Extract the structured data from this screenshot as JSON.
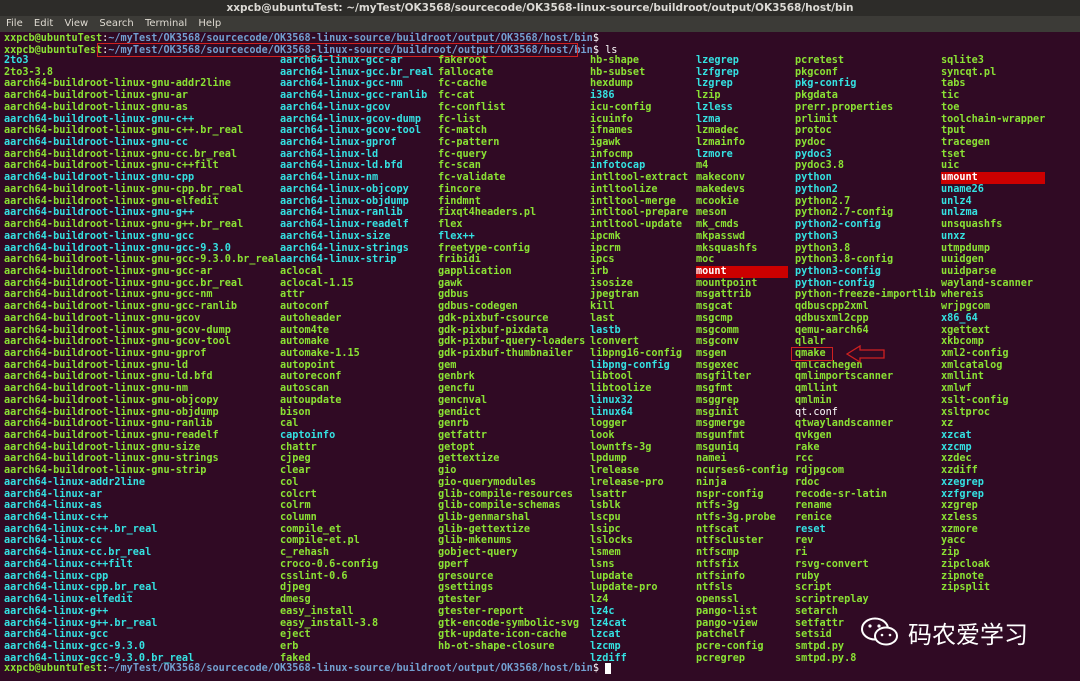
{
  "window": {
    "title": "xxpcb@ubuntuTest: ~/myTest/OK3568/sourcecode/OK3568-linux-source/buildroot/output/OK3568/host/bin"
  },
  "menu": [
    "File",
    "Edit",
    "View",
    "Search",
    "Terminal",
    "Help"
  ],
  "prompt": {
    "user": "xxpcb@ubuntuTest",
    "sep": ":",
    "path": "~/myTest/OK3568/sourcecode/OK3568-linux-source/buildroot/output/OK3568/host/bin",
    "end": "$ "
  },
  "command": "ls",
  "colors": {
    "executable": "#8ae234",
    "symlink": "#34e2e2",
    "directory": "#729fcf",
    "highlight": "#cc0000"
  },
  "columns": [
    [
      [
        "2to3",
        "c"
      ],
      [
        "2to3-3.8",
        "g"
      ],
      [
        "aarch64-buildroot-linux-gnu-addr2line",
        "g"
      ],
      [
        "aarch64-buildroot-linux-gnu-ar",
        "g"
      ],
      [
        "aarch64-buildroot-linux-gnu-as",
        "g"
      ],
      [
        "aarch64-buildroot-linux-gnu-c++",
        "c"
      ],
      [
        "aarch64-buildroot-linux-gnu-c++.br_real",
        "g"
      ],
      [
        "aarch64-buildroot-linux-gnu-cc",
        "c"
      ],
      [
        "aarch64-buildroot-linux-gnu-cc.br_real",
        "g"
      ],
      [
        "aarch64-buildroot-linux-gnu-c++filt",
        "g"
      ],
      [
        "aarch64-buildroot-linux-gnu-cpp",
        "c"
      ],
      [
        "aarch64-buildroot-linux-gnu-cpp.br_real",
        "g"
      ],
      [
        "aarch64-buildroot-linux-gnu-elfedit",
        "g"
      ],
      [
        "aarch64-buildroot-linux-gnu-g++",
        "c"
      ],
      [
        "aarch64-buildroot-linux-gnu-g++.br_real",
        "g"
      ],
      [
        "aarch64-buildroot-linux-gnu-gcc",
        "c"
      ],
      [
        "aarch64-buildroot-linux-gnu-gcc-9.3.0",
        "c"
      ],
      [
        "aarch64-buildroot-linux-gnu-gcc-9.3.0.br_real",
        "g"
      ],
      [
        "aarch64-buildroot-linux-gnu-gcc-ar",
        "g"
      ],
      [
        "aarch64-buildroot-linux-gnu-gcc.br_real",
        "g"
      ],
      [
        "aarch64-buildroot-linux-gnu-gcc-nm",
        "g"
      ],
      [
        "aarch64-buildroot-linux-gnu-gcc-ranlib",
        "g"
      ],
      [
        "aarch64-buildroot-linux-gnu-gcov",
        "g"
      ],
      [
        "aarch64-buildroot-linux-gnu-gcov-dump",
        "g"
      ],
      [
        "aarch64-buildroot-linux-gnu-gcov-tool",
        "g"
      ],
      [
        "aarch64-buildroot-linux-gnu-gprof",
        "g"
      ],
      [
        "aarch64-buildroot-linux-gnu-ld",
        "g"
      ],
      [
        "aarch64-buildroot-linux-gnu-ld.bfd",
        "g"
      ],
      [
        "aarch64-buildroot-linux-gnu-nm",
        "g"
      ],
      [
        "aarch64-buildroot-linux-gnu-objcopy",
        "g"
      ],
      [
        "aarch64-buildroot-linux-gnu-objdump",
        "g"
      ],
      [
        "aarch64-buildroot-linux-gnu-ranlib",
        "g"
      ],
      [
        "aarch64-buildroot-linux-gnu-readelf",
        "g"
      ],
      [
        "aarch64-buildroot-linux-gnu-size",
        "g"
      ],
      [
        "aarch64-buildroot-linux-gnu-strings",
        "g"
      ],
      [
        "aarch64-buildroot-linux-gnu-strip",
        "g"
      ],
      [
        "aarch64-linux-addr2line",
        "c"
      ],
      [
        "aarch64-linux-ar",
        "c"
      ],
      [
        "aarch64-linux-as",
        "c"
      ],
      [
        "aarch64-linux-c++",
        "c"
      ],
      [
        "aarch64-linux-c++.br_real",
        "c"
      ],
      [
        "aarch64-linux-cc",
        "c"
      ],
      [
        "aarch64-linux-cc.br_real",
        "c"
      ],
      [
        "aarch64-linux-c++filt",
        "c"
      ],
      [
        "aarch64-linux-cpp",
        "c"
      ],
      [
        "aarch64-linux-cpp.br_real",
        "c"
      ],
      [
        "aarch64-linux-elfedit",
        "c"
      ],
      [
        "aarch64-linux-g++",
        "c"
      ],
      [
        "aarch64-linux-g++.br_real",
        "c"
      ],
      [
        "aarch64-linux-gcc",
        "c"
      ],
      [
        "aarch64-linux-gcc-9.3.0",
        "c"
      ],
      [
        "aarch64-linux-gcc-9.3.0.br_real",
        "c"
      ]
    ],
    [
      [
        "aarch64-linux-gcc-ar",
        "c"
      ],
      [
        "aarch64-linux-gcc.br_real",
        "c"
      ],
      [
        "aarch64-linux-gcc-nm",
        "c"
      ],
      [
        "aarch64-linux-gcc-ranlib",
        "c"
      ],
      [
        "aarch64-linux-gcov",
        "c"
      ],
      [
        "aarch64-linux-gcov-dump",
        "c"
      ],
      [
        "aarch64-linux-gcov-tool",
        "c"
      ],
      [
        "aarch64-linux-gprof",
        "c"
      ],
      [
        "aarch64-linux-ld",
        "c"
      ],
      [
        "aarch64-linux-ld.bfd",
        "c"
      ],
      [
        "aarch64-linux-nm",
        "c"
      ],
      [
        "aarch64-linux-objcopy",
        "c"
      ],
      [
        "aarch64-linux-objdump",
        "c"
      ],
      [
        "aarch64-linux-ranlib",
        "c"
      ],
      [
        "aarch64-linux-readelf",
        "c"
      ],
      [
        "aarch64-linux-size",
        "c"
      ],
      [
        "aarch64-linux-strings",
        "c"
      ],
      [
        "aarch64-linux-strip",
        "c"
      ],
      [
        "aclocal",
        "g"
      ],
      [
        "aclocal-1.15",
        "g"
      ],
      [
        "attr",
        "g"
      ],
      [
        "autoconf",
        "g"
      ],
      [
        "autoheader",
        "g"
      ],
      [
        "autom4te",
        "g"
      ],
      [
        "automake",
        "g"
      ],
      [
        "automake-1.15",
        "g"
      ],
      [
        "autopoint",
        "g"
      ],
      [
        "autoreconf",
        "g"
      ],
      [
        "autoscan",
        "g"
      ],
      [
        "autoupdate",
        "g"
      ],
      [
        "bison",
        "g"
      ],
      [
        "cal",
        "g"
      ],
      [
        "captoinfo",
        "c"
      ],
      [
        "chattr",
        "g"
      ],
      [
        "cjpeg",
        "g"
      ],
      [
        "clear",
        "g"
      ],
      [
        "col",
        "g"
      ],
      [
        "colcrt",
        "g"
      ],
      [
        "colrm",
        "g"
      ],
      [
        "column",
        "g"
      ],
      [
        "compile_et",
        "g"
      ],
      [
        "compile-et.pl",
        "g"
      ],
      [
        "c_rehash",
        "g"
      ],
      [
        "croco-0.6-config",
        "g"
      ],
      [
        "csslint-0.6",
        "g"
      ],
      [
        "djpeg",
        "g"
      ],
      [
        "dmesg",
        "g"
      ],
      [
        "easy_install",
        "g"
      ],
      [
        "easy_install-3.8",
        "g"
      ],
      [
        "eject",
        "g"
      ],
      [
        "erb",
        "g"
      ],
      [
        "faked",
        "g"
      ]
    ],
    [
      [
        "fakeroot",
        "g"
      ],
      [
        "fallocate",
        "g"
      ],
      [
        "fc-cache",
        "g"
      ],
      [
        "fc-cat",
        "g"
      ],
      [
        "fc-conflist",
        "g"
      ],
      [
        "fc-list",
        "g"
      ],
      [
        "fc-match",
        "g"
      ],
      [
        "fc-pattern",
        "g"
      ],
      [
        "fc-query",
        "g"
      ],
      [
        "fc-scan",
        "g"
      ],
      [
        "fc-validate",
        "g"
      ],
      [
        "fincore",
        "g"
      ],
      [
        "findmnt",
        "g"
      ],
      [
        "fixqt4headers.pl",
        "g"
      ],
      [
        "flex",
        "g"
      ],
      [
        "flex++",
        "c"
      ],
      [
        "freetype-config",
        "g"
      ],
      [
        "fribidi",
        "g"
      ],
      [
        "gapplication",
        "g"
      ],
      [
        "gawk",
        "g"
      ],
      [
        "gdbus",
        "g"
      ],
      [
        "gdbus-codegen",
        "g"
      ],
      [
        "gdk-pixbuf-csource",
        "g"
      ],
      [
        "gdk-pixbuf-pixdata",
        "g"
      ],
      [
        "gdk-pixbuf-query-loaders",
        "g"
      ],
      [
        "gdk-pixbuf-thumbnailer",
        "g"
      ],
      [
        "gem",
        "g"
      ],
      [
        "genbrk",
        "g"
      ],
      [
        "gencfu",
        "g"
      ],
      [
        "gencnval",
        "g"
      ],
      [
        "gendict",
        "g"
      ],
      [
        "genrb",
        "g"
      ],
      [
        "getfattr",
        "g"
      ],
      [
        "getopt",
        "g"
      ],
      [
        "gettextize",
        "g"
      ],
      [
        "gio",
        "g"
      ],
      [
        "gio-querymodules",
        "g"
      ],
      [
        "glib-compile-resources",
        "g"
      ],
      [
        "glib-compile-schemas",
        "g"
      ],
      [
        "glib-genmarshal",
        "g"
      ],
      [
        "glib-gettextize",
        "g"
      ],
      [
        "glib-mkenums",
        "g"
      ],
      [
        "gobject-query",
        "g"
      ],
      [
        "gperf",
        "g"
      ],
      [
        "gresource",
        "g"
      ],
      [
        "gsettings",
        "g"
      ],
      [
        "gtester",
        "g"
      ],
      [
        "gtester-report",
        "g"
      ],
      [
        "gtk-encode-symbolic-svg",
        "g"
      ],
      [
        "gtk-update-icon-cache",
        "g"
      ],
      [
        "hb-ot-shape-closure",
        "g"
      ]
    ],
    [
      [
        "hb-shape",
        "g"
      ],
      [
        "hb-subset",
        "g"
      ],
      [
        "hexdump",
        "g"
      ],
      [
        "i386",
        "c"
      ],
      [
        "icu-config",
        "g"
      ],
      [
        "icuinfo",
        "g"
      ],
      [
        "ifnames",
        "g"
      ],
      [
        "igawk",
        "g"
      ],
      [
        "infocmp",
        "g"
      ],
      [
        "infotocap",
        "c"
      ],
      [
        "intltool-extract",
        "g"
      ],
      [
        "intltoolize",
        "g"
      ],
      [
        "intltool-merge",
        "g"
      ],
      [
        "intltool-prepare",
        "g"
      ],
      [
        "intltool-update",
        "g"
      ],
      [
        "ipcmk",
        "g"
      ],
      [
        "ipcrm",
        "g"
      ],
      [
        "ipcs",
        "g"
      ],
      [
        "irb",
        "g"
      ],
      [
        "isosize",
        "g"
      ],
      [
        "jpegtran",
        "g"
      ],
      [
        "kill",
        "g"
      ],
      [
        "last",
        "g"
      ],
      [
        "lastb",
        "c"
      ],
      [
        "lconvert",
        "g"
      ],
      [
        "libpng16-config",
        "g"
      ],
      [
        "libpng-config",
        "c"
      ],
      [
        "libtool",
        "g"
      ],
      [
        "libtoolize",
        "g"
      ],
      [
        "linux32",
        "c"
      ],
      [
        "linux64",
        "c"
      ],
      [
        "logger",
        "g"
      ],
      [
        "look",
        "g"
      ],
      [
        "lowntfs-3g",
        "g"
      ],
      [
        "lpdump",
        "g"
      ],
      [
        "lrelease",
        "g"
      ],
      [
        "lrelease-pro",
        "g"
      ],
      [
        "lsattr",
        "g"
      ],
      [
        "lsblk",
        "g"
      ],
      [
        "lscpu",
        "g"
      ],
      [
        "lsipc",
        "g"
      ],
      [
        "lslocks",
        "g"
      ],
      [
        "lsmem",
        "g"
      ],
      [
        "lsns",
        "g"
      ],
      [
        "lupdate",
        "g"
      ],
      [
        "lupdate-pro",
        "g"
      ],
      [
        "lz4",
        "g"
      ],
      [
        "lz4c",
        "c"
      ],
      [
        "lz4cat",
        "c"
      ],
      [
        "lzcat",
        "c"
      ],
      [
        "lzcmp",
        "c"
      ],
      [
        "lzdiff",
        "c"
      ]
    ],
    [
      [
        "lzegrep",
        "c"
      ],
      [
        "lzfgrep",
        "c"
      ],
      [
        "lzgrep",
        "c"
      ],
      [
        "lzip",
        "g"
      ],
      [
        "lzless",
        "c"
      ],
      [
        "lzma",
        "c"
      ],
      [
        "lzmadec",
        "g"
      ],
      [
        "lzmainfo",
        "g"
      ],
      [
        "lzmore",
        "c"
      ],
      [
        "m4",
        "g"
      ],
      [
        "makeconv",
        "g"
      ],
      [
        "makedevs",
        "g"
      ],
      [
        "mcookie",
        "g"
      ],
      [
        "meson",
        "g"
      ],
      [
        "mk_cmds",
        "g"
      ],
      [
        "mkpasswd",
        "g"
      ],
      [
        "mksquashfs",
        "g"
      ],
      [
        "moc",
        "g"
      ],
      [
        "mount",
        "r"
      ],
      [
        "mountpoint",
        "g"
      ],
      [
        "msgattrib",
        "g"
      ],
      [
        "msgcat",
        "g"
      ],
      [
        "msgcmp",
        "g"
      ],
      [
        "msgcomm",
        "g"
      ],
      [
        "msgconv",
        "g"
      ],
      [
        "msgen",
        "g"
      ],
      [
        "msgexec",
        "g"
      ],
      [
        "msgfilter",
        "g"
      ],
      [
        "msgfmt",
        "g"
      ],
      [
        "msggrep",
        "g"
      ],
      [
        "msginit",
        "g"
      ],
      [
        "msgmerge",
        "g"
      ],
      [
        "msgunfmt",
        "g"
      ],
      [
        "msguniq",
        "g"
      ],
      [
        "namei",
        "g"
      ],
      [
        "ncurses6-config",
        "g"
      ],
      [
        "ninja",
        "g"
      ],
      [
        "nspr-config",
        "g"
      ],
      [
        "ntfs-3g",
        "g"
      ],
      [
        "ntfs-3g.probe",
        "g"
      ],
      [
        "ntfscat",
        "g"
      ],
      [
        "ntfscluster",
        "g"
      ],
      [
        "ntfscmp",
        "g"
      ],
      [
        "ntfsfix",
        "g"
      ],
      [
        "ntfsinfo",
        "g"
      ],
      [
        "ntfsls",
        "g"
      ],
      [
        "openssl",
        "g"
      ],
      [
        "pango-list",
        "g"
      ],
      [
        "pango-view",
        "g"
      ],
      [
        "patchelf",
        "g"
      ],
      [
        "pcre-config",
        "g"
      ],
      [
        "pcregrep",
        "g"
      ]
    ],
    [
      [
        "pcretest",
        "g"
      ],
      [
        "pkgconf",
        "g"
      ],
      [
        "pkg-config",
        "c"
      ],
      [
        "pkgdata",
        "g"
      ],
      [
        "prerr.properties",
        "g"
      ],
      [
        "prlimit",
        "g"
      ],
      [
        "protoc",
        "g"
      ],
      [
        "pydoc",
        "g"
      ],
      [
        "pydoc3",
        "c"
      ],
      [
        "pydoc3.8",
        "g"
      ],
      [
        "python",
        "c"
      ],
      [
        "python2",
        "c"
      ],
      [
        "python2.7",
        "g"
      ],
      [
        "python2.7-config",
        "g"
      ],
      [
        "python2-config",
        "c"
      ],
      [
        "python3",
        "c"
      ],
      [
        "python3.8",
        "g"
      ],
      [
        "python3.8-config",
        "g"
      ],
      [
        "python3-config",
        "c"
      ],
      [
        "python-config",
        "c"
      ],
      [
        "python-freeze-importlib",
        "g"
      ],
      [
        "qdbuscpp2xml",
        "g"
      ],
      [
        "qdbusxml2cpp",
        "g"
      ],
      [
        "qemu-aarch64",
        "g"
      ],
      [
        "qlalr",
        "g"
      ],
      [
        "qmake",
        "g"
      ],
      [
        "qmlcachegen",
        "g"
      ],
      [
        "qmlimportscanner",
        "g"
      ],
      [
        "qmllint",
        "g"
      ],
      [
        "qmlmin",
        "g"
      ],
      [
        "qt.conf",
        "w"
      ],
      [
        "qtwaylandscanner",
        "g"
      ],
      [
        "qvkgen",
        "g"
      ],
      [
        "rake",
        "g"
      ],
      [
        "rcc",
        "g"
      ],
      [
        "rdjpgcom",
        "g"
      ],
      [
        "rdoc",
        "g"
      ],
      [
        "recode-sr-latin",
        "g"
      ],
      [
        "rename",
        "g"
      ],
      [
        "renice",
        "g"
      ],
      [
        "reset",
        "c"
      ],
      [
        "rev",
        "g"
      ],
      [
        "ri",
        "g"
      ],
      [
        "rsvg-convert",
        "g"
      ],
      [
        "ruby",
        "g"
      ],
      [
        "script",
        "g"
      ],
      [
        "scriptreplay",
        "g"
      ],
      [
        "setarch",
        "g"
      ],
      [
        "setfattr",
        "g"
      ],
      [
        "setsid",
        "g"
      ],
      [
        "smtpd.py",
        "g"
      ],
      [
        "smtpd.py.8",
        "g"
      ]
    ],
    [
      [
        "sqlite3",
        "g"
      ],
      [
        "syncqt.pl",
        "g"
      ],
      [
        "tabs",
        "g"
      ],
      [
        "tic",
        "g"
      ],
      [
        "toe",
        "g"
      ],
      [
        "toolchain-wrapper",
        "g"
      ],
      [
        "tput",
        "g"
      ],
      [
        "tracegen",
        "g"
      ],
      [
        "tset",
        "g"
      ],
      [
        "uic",
        "g"
      ],
      [
        "umount",
        "r"
      ],
      [
        "uname26",
        "c"
      ],
      [
        "unlz4",
        "c"
      ],
      [
        "unlzma",
        "c"
      ],
      [
        "unsquashfs",
        "g"
      ],
      [
        "unxz",
        "c"
      ],
      [
        "utmpdump",
        "g"
      ],
      [
        "uuidgen",
        "g"
      ],
      [
        "uuidparse",
        "g"
      ],
      [
        "wayland-scanner",
        "g"
      ],
      [
        "whereis",
        "g"
      ],
      [
        "wrjpgcom",
        "g"
      ],
      [
        "x86_64",
        "c"
      ],
      [
        "xgettext",
        "g"
      ],
      [
        "xkbcomp",
        "g"
      ],
      [
        "xml2-config",
        "g"
      ],
      [
        "xmlcatalog",
        "g"
      ],
      [
        "xmllint",
        "g"
      ],
      [
        "xmlwf",
        "g"
      ],
      [
        "xslt-config",
        "g"
      ],
      [
        "xsltproc",
        "g"
      ],
      [
        "xz",
        "g"
      ],
      [
        "xzcat",
        "c"
      ],
      [
        "xzcmp",
        "c"
      ],
      [
        "xzdec",
        "g"
      ],
      [
        "xzdiff",
        "g"
      ],
      [
        "xzegrep",
        "c"
      ],
      [
        "xzfgrep",
        "c"
      ],
      [
        "xzgrep",
        "g"
      ],
      [
        "xzless",
        "g"
      ],
      [
        "xzmore",
        "g"
      ],
      [
        "yacc",
        "g"
      ],
      [
        "zip",
        "g"
      ],
      [
        "zipcloak",
        "g"
      ],
      [
        "zipnote",
        "g"
      ],
      [
        "zipsplit",
        "g"
      ]
    ]
  ],
  "watermark": {
    "text": "码农爱学习",
    "icon": "wechat-icon"
  }
}
